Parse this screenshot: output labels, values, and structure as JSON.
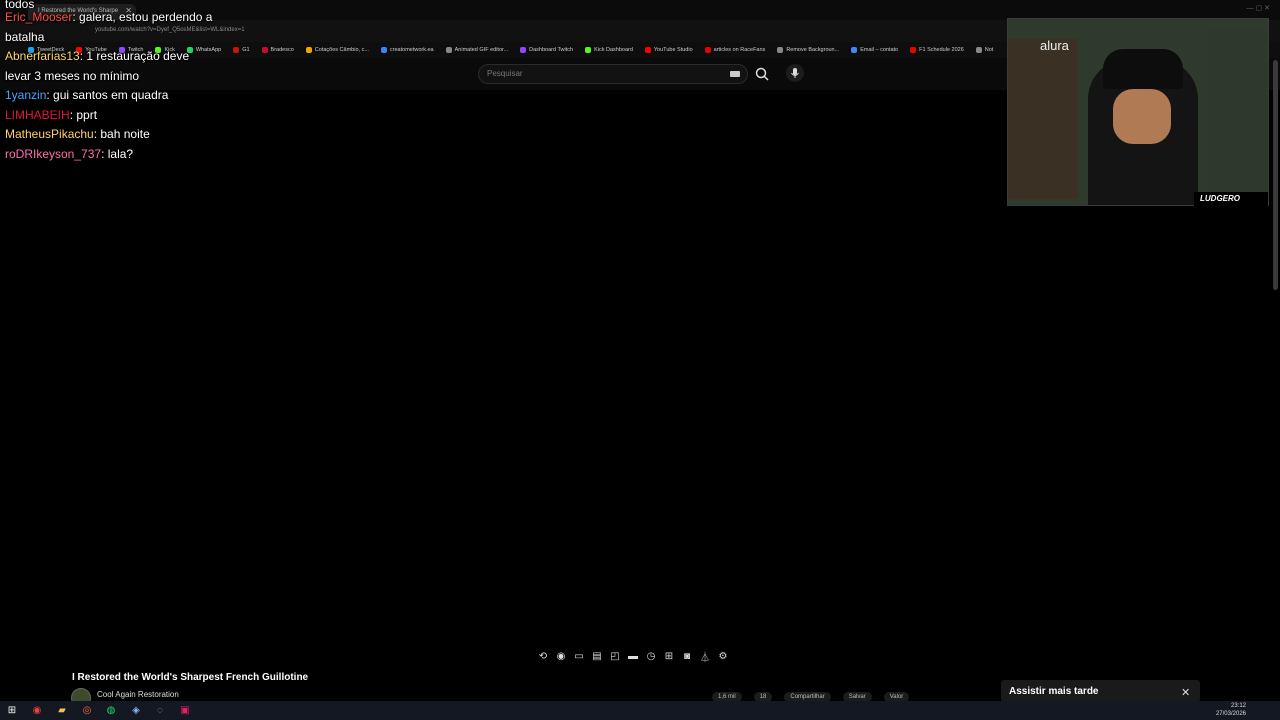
{
  "browser": {
    "tab_title": "I Restored the World's Sharpe",
    "url": "youtube.com/watch?v=Dyef_Q5osME&list=WL&index=1",
    "bookmarks": [
      "TweetDeck",
      "YouTube",
      "Twitch",
      "Kick",
      "WhatsApp",
      "G1",
      "Bradesco",
      "Cotações Câmbio, c...",
      "creatometwork.ea",
      "Animated GIF editor...",
      "Dashboard Twitch",
      "Kick Dashboard",
      "YouTube Studio",
      "articles on RaceFans",
      "Remove Backgroun...",
      "Email – contato",
      "F1 Schedule 2026",
      "Not"
    ],
    "bookmark_colors": [
      "#1da1f2",
      "#ff0000",
      "#9146ff",
      "#53fc18",
      "#25d366",
      "#c4170c",
      "#cc092f",
      "#f4a300",
      "#3b82f6",
      "#888888",
      "#9146ff",
      "#53fc18",
      "#ff0000",
      "#e10600",
      "#888888",
      "#4285f4",
      "#e10600",
      "#888888"
    ]
  },
  "youtube": {
    "search_placeholder": "Pesquisar",
    "video_title": "I Restored the World's Sharpest French Guillotine",
    "channel_name": "Cool Again Restoration",
    "actions": [
      "1,6 mil",
      "18",
      "Compartilhar",
      "Salvar",
      "Valor"
    ],
    "toast_text": "Assistir mais tarde"
  },
  "chat": {
    "top_fragment": "todos",
    "messages": [
      {
        "user": "Eric_Mooser",
        "user_color": "#ff4d4d",
        "text": ": galera, estou perdendo a batalha"
      },
      {
        "user": "Abnerfarias13",
        "user_color": "#ffd36b",
        "text": ": 1 restauração deve levar 3 meses no mínimo"
      },
      {
        "user": "1yanzin",
        "user_color": "#4da3ff",
        "text": ": gui santos em quadra"
      },
      {
        "user": "LIMHABEIH",
        "user_color": "#e0173b",
        "text": ": pprt"
      },
      {
        "user": "MatheusPikachu",
        "user_color": "#ffd36b",
        "text": ": bah noite"
      },
      {
        "user": "roDRIkeyson_737",
        "user_color": "#ff6fb1",
        "text": ": lala?"
      }
    ]
  },
  "overlay": {
    "cam_logo": "LUDGERO",
    "cam_sign": "alura"
  },
  "taskbar": {
    "time": "23:12",
    "date": "27/03/2026"
  }
}
